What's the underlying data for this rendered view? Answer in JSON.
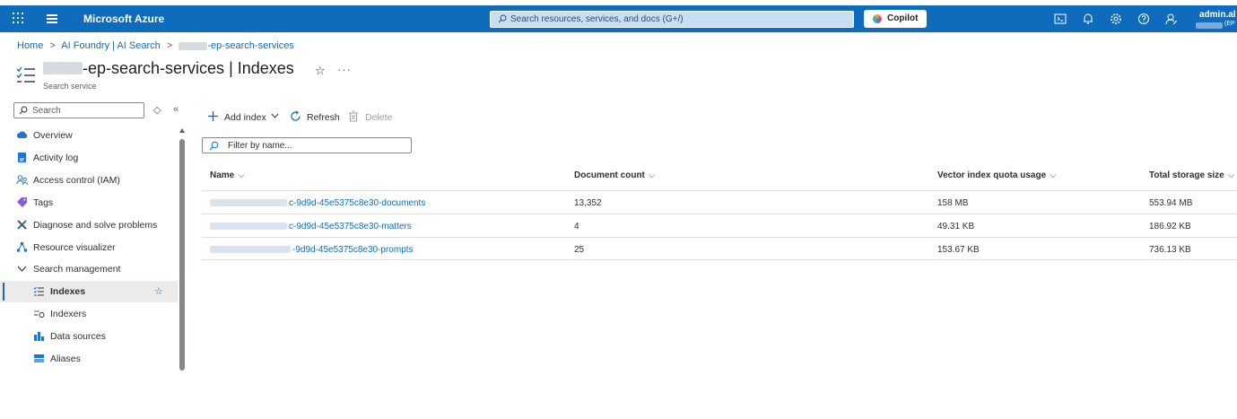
{
  "topbar": {
    "brand": "Microsoft Azure",
    "search_placeholder": "Search resources, services, and docs (G+/)",
    "copilot_label": "Copilot",
    "user_name": "admin.al",
    "user_tenant": "(EP",
    "icons": [
      "waffle-icon",
      "hamburger-icon",
      "cloud-shell-icon",
      "notifications-icon",
      "settings-icon",
      "help-icon",
      "feedback-icon"
    ]
  },
  "breadcrumb": {
    "items": [
      "Home",
      "AI Foundry | AI Search",
      "-ep-search-services"
    ],
    "separator": ">"
  },
  "header": {
    "title_name": "-ep-search-services",
    "title_section": "| Indexes",
    "subtitle": "Search service"
  },
  "sidebar": {
    "search_placeholder": "Search",
    "items": [
      {
        "label": "Overview",
        "icon": "overview-cloud-icon"
      },
      {
        "label": "Activity log",
        "icon": "activity-log-icon"
      },
      {
        "label": "Access control (IAM)",
        "icon": "iam-people-icon"
      },
      {
        "label": "Tags",
        "icon": "tag-icon"
      },
      {
        "label": "Diagnose and solve problems",
        "icon": "wrench-icon"
      },
      {
        "label": "Resource visualizer",
        "icon": "visualizer-icon"
      },
      {
        "label": "Search management",
        "icon": "chevron-down-icon"
      },
      {
        "label": "Indexes",
        "icon": "index-list-icon",
        "active": true
      },
      {
        "label": "Indexers",
        "icon": "indexer-icon"
      },
      {
        "label": "Data sources",
        "icon": "data-source-icon"
      },
      {
        "label": "Aliases",
        "icon": "alias-icon"
      }
    ]
  },
  "toolbar": {
    "add_index": "Add index",
    "refresh": "Refresh",
    "delete": "Delete"
  },
  "filter": {
    "placeholder": "Filter by name..."
  },
  "table": {
    "columns": [
      "Name",
      "Document count",
      "Vector index quota usage",
      "Total storage size"
    ],
    "rows": [
      {
        "name": "c-9d9d-45e5375c8e30-documents",
        "document_count": "13,352",
        "vector_usage": "158 MB",
        "storage": "553.94 MB"
      },
      {
        "name": "c-9d9d-45e5375c8e30-matters",
        "document_count": "4",
        "vector_usage": "49.31 KB",
        "storage": "186.92 KB"
      },
      {
        "name": "-9d9d-45e5375c8e30-prompts",
        "document_count": "25",
        "vector_usage": "153.67 KB",
        "storage": "736.13 KB"
      }
    ]
  },
  "colors": {
    "brand": "#0f6cbd",
    "link": "#0f6cbd",
    "active_bg": "#edebe9"
  }
}
